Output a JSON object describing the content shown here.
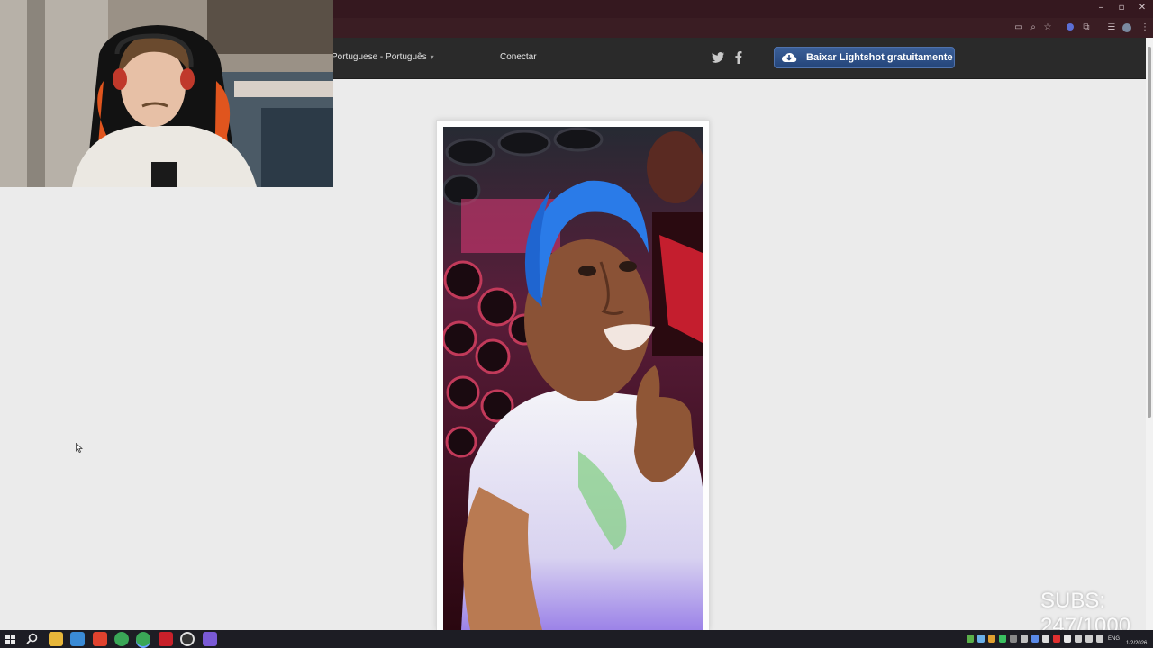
{
  "browser": {
    "window_controls": {
      "minimize": "–",
      "restore": "▫",
      "close": "✕"
    }
  },
  "site_header": {
    "language": "Portuguese - Português",
    "connect": "Conectar",
    "download_button": "Baixar Lightshot gratuitamente",
    "social": [
      "twitter-icon",
      "facebook-icon"
    ]
  },
  "overlay": {
    "subs_label": "SUBS:",
    "subs_count": "247/1000"
  },
  "taskbar": {
    "language": "ENG",
    "date": "1/2/2026"
  },
  "colors": {
    "accent_button": "#2f5289",
    "header_bg": "#2a2a2a",
    "browser_bg": "#35181f"
  }
}
